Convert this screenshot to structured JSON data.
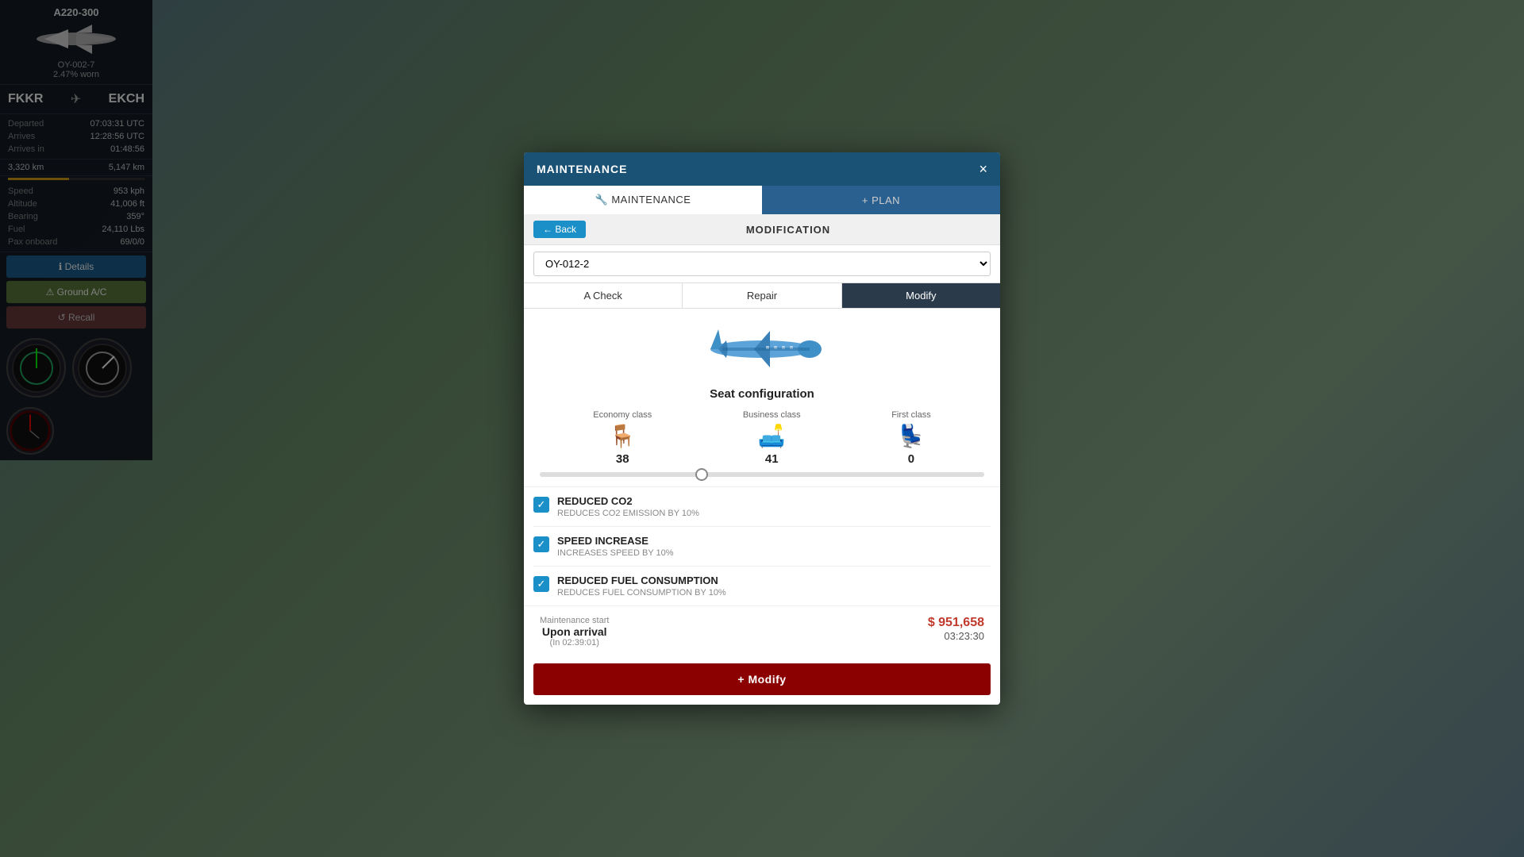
{
  "sidebar": {
    "aircraft_type": "A220-300",
    "aircraft_registration": "OY-002-7",
    "aircraft_worn": "2.47% worn",
    "route_from": "FKKR",
    "route_to": "EKCH",
    "departed_label": "Departed",
    "departed_value": "07:03:31 UTC",
    "arrives_label": "Arrives",
    "arrives_value": "12:28:56 UTC",
    "arrives_in_label": "Arrives in",
    "arrives_in_value": "01:48:56",
    "dist_covered": "3,320 km",
    "dist_total": "5,147 km",
    "speed_label": "Speed",
    "speed_value": "953 kph",
    "altitude_label": "Altitude",
    "altitude_value": "41,006 ft",
    "bearing_label": "Bearing",
    "bearing_value": "359°",
    "fuel_label": "Fuel",
    "fuel_value": "24,110 Lbs",
    "pax_label": "Pax onboard",
    "pax_value": "69/0/0",
    "btn_details": "ℹ Details",
    "btn_ground": "⚠ Ground A/C",
    "btn_recall": "↺ Recall"
  },
  "modal": {
    "title": "MAINTENANCE",
    "close_label": "×",
    "tab_maintenance": "🔧 MAINTENANCE",
    "tab_plan": "+ PLAN",
    "back_label": "← Back",
    "section_title": "MODIFICATION",
    "dropdown_value": "OY-012-2",
    "dropdown_options": [
      "OY-012-2"
    ],
    "tab_acheck": "A Check",
    "tab_repair": "Repair",
    "tab_modify": "Modify",
    "seat_config_title": "Seat configuration",
    "economy_label": "Economy class",
    "economy_count": "38",
    "business_label": "Business class",
    "business_count": "41",
    "first_label": "First class",
    "first_count": "0",
    "reduced_co2_title": "REDUCED CO2",
    "reduced_co2_desc": "REDUCES CO2 EMISSION BY 10%",
    "speed_increase_title": "SPEED INCREASE",
    "speed_increase_desc": "INCREASES SPEED BY 10%",
    "reduced_fuel_title": "REDUCED FUEL CONSUMPTION",
    "reduced_fuel_desc": "REDUCES FUEL CONSUMPTION BY 10%",
    "maint_start_label": "Maintenance start",
    "maint_start_value": "Upon arrival",
    "maint_start_sub": "(In 02:39:01)",
    "cost_amount": "$ 951,658",
    "cost_time": "03:23:30",
    "modify_btn_label": "+ Modify"
  }
}
